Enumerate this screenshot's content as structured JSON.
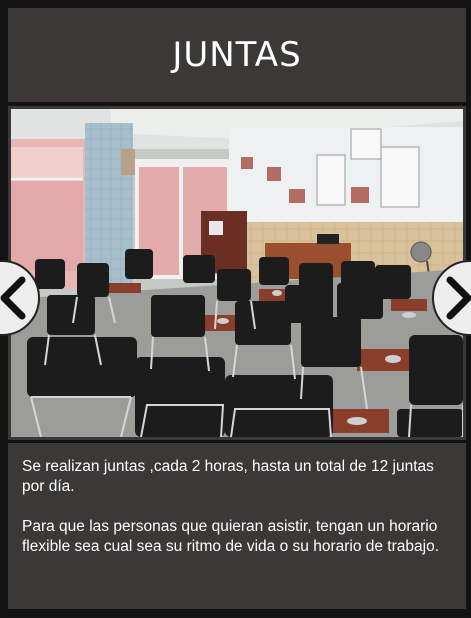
{
  "header": {
    "title": "JUNTAS"
  },
  "gallery": {
    "image_alt": "Sala de juntas con sillas negras y mesas pequeñas",
    "prev_icon": "chevron-left-icon",
    "next_icon": "chevron-right-icon"
  },
  "description": {
    "paragraph_1": "Se realizan juntas ,cada 2 horas, hasta un total de 12 juntas por día.",
    "paragraph_2": "Para  que las personas que quieran asistir, tengan un horario flexible sea cual sea su ritmo de vida o su horario de trabajo."
  },
  "colors": {
    "background": "#121212",
    "panel": "#3a3938",
    "text": "#ffffff",
    "nav_button": "#ededed"
  }
}
